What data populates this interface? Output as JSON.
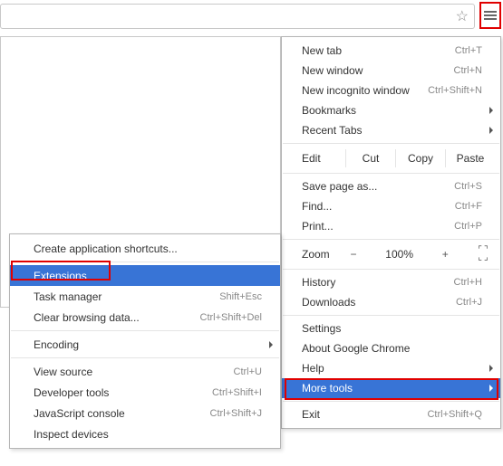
{
  "icons": {
    "star": "☆"
  },
  "mainMenu": {
    "group1": [
      {
        "label": "New tab",
        "shortcut": "Ctrl+T"
      },
      {
        "label": "New window",
        "shortcut": "Ctrl+N"
      },
      {
        "label": "New incognito window",
        "shortcut": "Ctrl+Shift+N"
      },
      {
        "label": "Bookmarks",
        "submenu": true
      },
      {
        "label": "Recent Tabs",
        "submenu": true
      }
    ],
    "editRow": {
      "lead": "Edit",
      "buttons": [
        "Cut",
        "Copy",
        "Paste"
      ]
    },
    "group2": [
      {
        "label": "Save page as...",
        "shortcut": "Ctrl+S"
      },
      {
        "label": "Find...",
        "shortcut": "Ctrl+F"
      },
      {
        "label": "Print...",
        "shortcut": "Ctrl+P"
      }
    ],
    "zoomRow": {
      "lead": "Zoom",
      "minus": "−",
      "value": "100%",
      "plus": "+"
    },
    "group3": [
      {
        "label": "History",
        "shortcut": "Ctrl+H"
      },
      {
        "label": "Downloads",
        "shortcut": "Ctrl+J"
      }
    ],
    "group4": [
      {
        "label": "Settings"
      },
      {
        "label": "About Google Chrome"
      },
      {
        "label": "Help",
        "submenu": true
      },
      {
        "label": "More tools",
        "submenu": true,
        "selected": true
      }
    ],
    "group5": [
      {
        "label": "Exit",
        "shortcut": "Ctrl+Shift+Q"
      }
    ]
  },
  "subMenu": {
    "group1": [
      {
        "label": "Create application shortcuts..."
      }
    ],
    "group2": [
      {
        "label": "Extensions",
        "selected": true
      },
      {
        "label": "Task manager",
        "shortcut": "Shift+Esc"
      },
      {
        "label": "Clear browsing data...",
        "shortcut": "Ctrl+Shift+Del"
      }
    ],
    "group3": [
      {
        "label": "Encoding",
        "submenu": true
      }
    ],
    "group4": [
      {
        "label": "View source",
        "shortcut": "Ctrl+U"
      },
      {
        "label": "Developer tools",
        "shortcut": "Ctrl+Shift+I"
      },
      {
        "label": "JavaScript console",
        "shortcut": "Ctrl+Shift+J"
      },
      {
        "label": "Inspect devices"
      }
    ]
  }
}
